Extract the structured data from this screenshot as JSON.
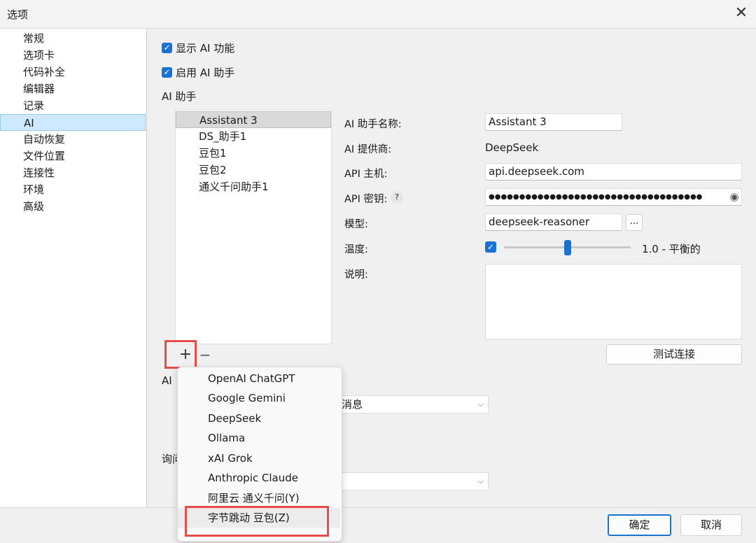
{
  "window": {
    "title": "选项",
    "close_glyph": "✕"
  },
  "nav": {
    "items": [
      "常规",
      "选项卡",
      "代码补全",
      "编辑器",
      "记录",
      "AI",
      "自动恢复",
      "文件位置",
      "连接性",
      "环境",
      "高级"
    ],
    "selected_index": 5
  },
  "ai": {
    "show_ai_label": "显示 AI 功能",
    "enable_assistant_label": "启用 AI 助手",
    "checkbox_glyph": "✓",
    "assistant_section_label": "AI 助手",
    "assistants": [
      "Assistant 3",
      "DS_助手1",
      "豆包1",
      "豆包2",
      "通义千问助手1"
    ],
    "selected_assistant_index": 0,
    "add_glyph": "+",
    "remove_glyph": "−",
    "details": {
      "name_label": "AI 助手名称:",
      "name_value": "Assistant 3",
      "provider_label": "AI 提供商:",
      "provider_value": "DeepSeek",
      "host_label": "API 主机:",
      "host_value": "api.deepseek.com",
      "key_label": "API 密钥:",
      "key_help_glyph": "?",
      "key_value": "●●●●●●●●●●●●●●●●●●●●●●●●●●●●●●●●●●●",
      "eye_glyph": "◉",
      "model_label": "模型:",
      "model_value": "deepseek-reasoner",
      "model_more_label": "...",
      "temperature_label": "温度:",
      "temperature_enabled": true,
      "temperature_fraction": 0.5,
      "temperature_text": "1.0 - 平衡的",
      "description_label": "说明:",
      "description_value": "",
      "test_button": "测试连接"
    },
    "partial_label_1": "AI",
    "partial_label_2": "询问",
    "dropdown_1_value": "消息",
    "dropdown_2_value": "",
    "chevron_glyph": "⌵"
  },
  "provider_menu": {
    "items": [
      "OpenAI ChatGPT",
      "Google Gemini",
      "DeepSeek",
      "Ollama",
      "xAI Grok",
      "Anthropic Claude",
      "阿里云 通义千问(Y)",
      "字节跳动 豆包(Z)"
    ],
    "highlighted_index": 7
  },
  "footer": {
    "ok": "确定",
    "cancel": "取消"
  },
  "colors": {
    "accent": "#1a73d2",
    "highlight_box": "#e74c4c",
    "nav_selected": "#cde8ff"
  }
}
